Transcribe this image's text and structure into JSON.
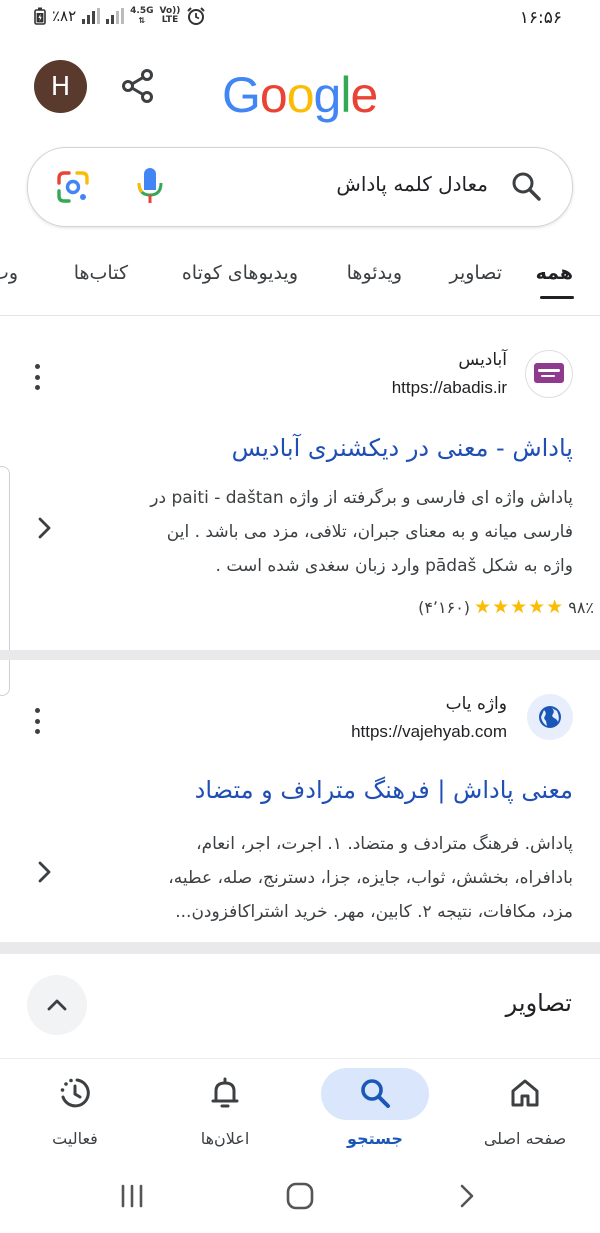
{
  "status_bar": {
    "time": "۱۶:۵۶",
    "battery": "٪۸۲",
    "network_label_top": "4.5G",
    "network_label_2": "Vo))",
    "network_label_3": "LTE"
  },
  "header": {
    "avatar_letter": "H",
    "logo_letters": [
      "G",
      "o",
      "o",
      "g",
      "l",
      "e"
    ],
    "logo_colors": [
      "#4285F4",
      "#EA4335",
      "#FBBC05",
      "#4285F4",
      "#34A853",
      "#EA4335"
    ]
  },
  "search": {
    "query": "معادل کلمه پاداش"
  },
  "tabs": [
    {
      "label": "همه",
      "active": true
    },
    {
      "label": "تصاویر",
      "active": false
    },
    {
      "label": "ویدئوها",
      "active": false
    },
    {
      "label": "ویدیوهای کوتاه",
      "active": false
    },
    {
      "label": "کتاب‌ها",
      "active": false
    },
    {
      "label": "وب",
      "active": false
    }
  ],
  "results": [
    {
      "site_name": "آبادیس",
      "url": "https://abadis.ir",
      "favicon": "abadis-icon",
      "title": "پاداش - معنی در دیکشنری آبادیس",
      "snippet_lines": [
        "پاداش واژه ای فارسی و برگرفته از واژه paiti - daštan در",
        "فارسی میانه و به معنای جبران، تلافی، مزد می باشد . این",
        "واژه به شکل pādaš وارد زبان سغدی شده است ."
      ],
      "rating_percent": "۹۸٪",
      "rating_stars": "★★★★★",
      "rating_count": "(۴٬۱۶۰)"
    },
    {
      "site_name": "واژه یاب",
      "url": "https://vajehyab.com",
      "favicon": "globe-icon",
      "title": "معنی پاداش | فرهنگ مترادف و متضاد",
      "snippet_lines": [
        "پاداش. فرهنگ مترادف و متضاد. ۱. اجرت، اجر، انعام،",
        "بادافراه، بخشش، ثواب، جایزه، جزا، دسترنج، صله، عطیه،",
        "مزد، مکافات، نتیجه ۲. کابین، مهر. خرید اشتراکافزودن..."
      ]
    }
  ],
  "images_section": {
    "title": "تصاویر"
  },
  "bottom_nav": [
    {
      "label": "صفحه اصلی",
      "icon": "home-icon",
      "active": false
    },
    {
      "label": "جستجو",
      "icon": "search-icon",
      "active": true
    },
    {
      "label": "اعلان‌ها",
      "icon": "bell-icon",
      "active": false
    },
    {
      "label": "فعالیت",
      "icon": "activity-icon",
      "active": false
    }
  ],
  "colors": {
    "link_blue": "#1f4fb5",
    "active_nav": "#1b57b7",
    "star": "#fbbc04"
  }
}
